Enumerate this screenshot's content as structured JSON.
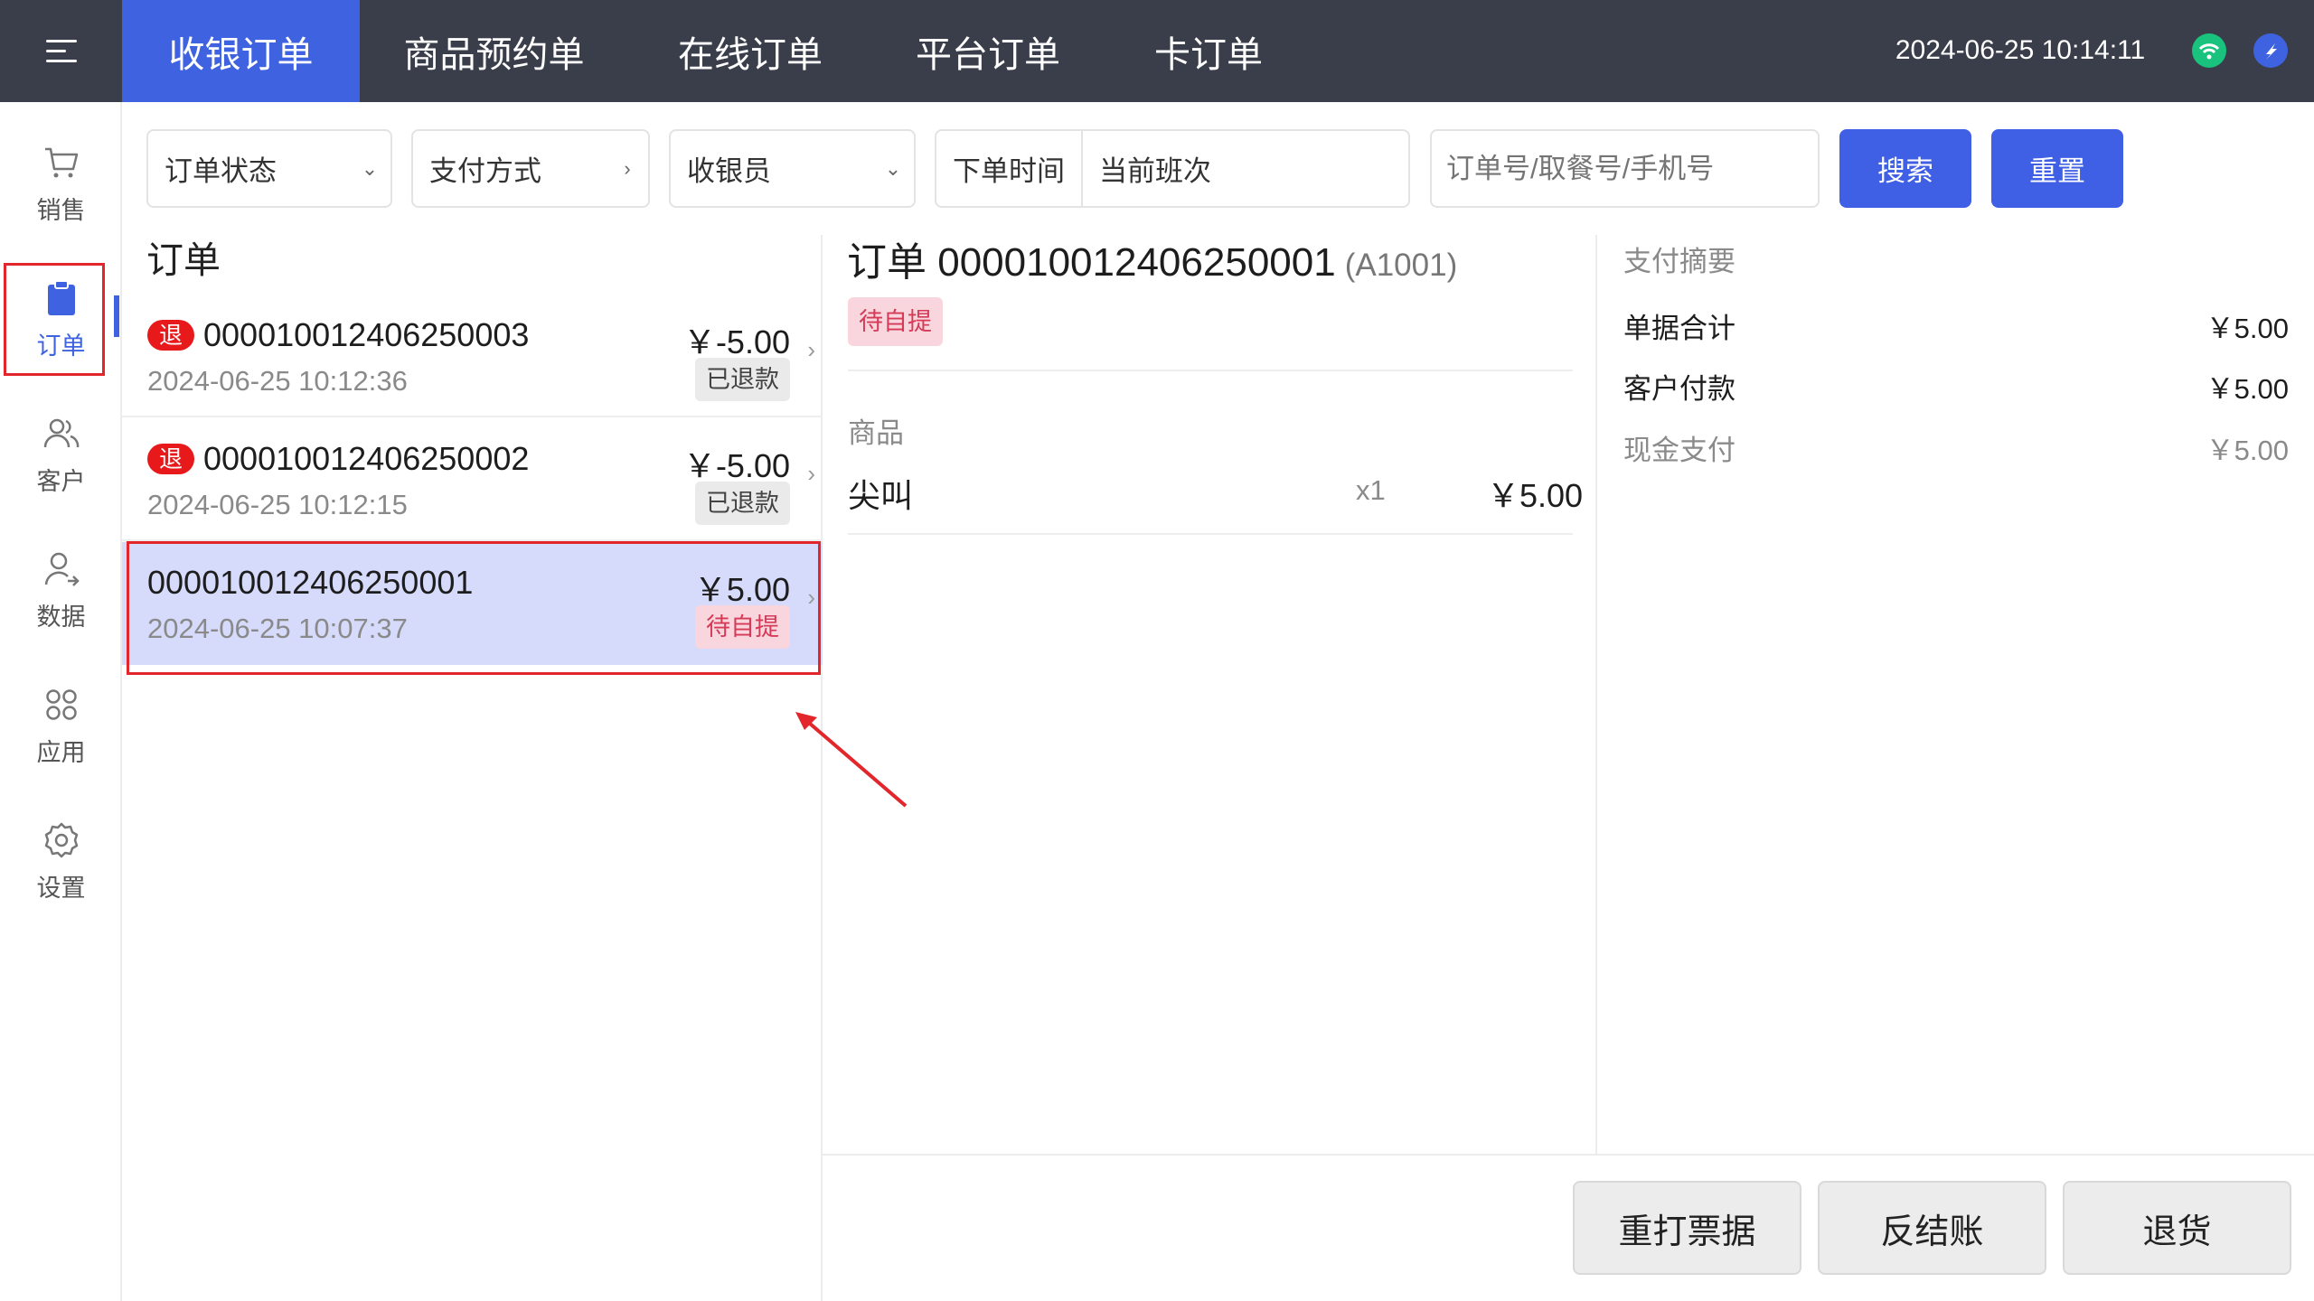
{
  "tabs": [
    {
      "label": "收银订单",
      "active": true
    },
    {
      "label": "商品预约单",
      "active": false
    },
    {
      "label": "在线订单",
      "active": false
    },
    {
      "label": "平台订单",
      "active": false
    },
    {
      "label": "卡订单",
      "active": false
    }
  ],
  "clock": "2024-06-25 10:14:11",
  "sidebar": [
    {
      "label": "销售",
      "icon": "cart-icon"
    },
    {
      "label": "订单",
      "icon": "clipboard-icon",
      "active": true
    },
    {
      "label": "客户",
      "icon": "users-icon"
    },
    {
      "label": "数据",
      "icon": "user-share-icon"
    },
    {
      "label": "应用",
      "icon": "apps-icon"
    },
    {
      "label": "设置",
      "icon": "gear-icon"
    }
  ],
  "filters": {
    "status": "订单状态",
    "payment": "支付方式",
    "cashier": "收银员",
    "time_label": "下单时间",
    "time_value": "当前班次",
    "search_placeholder": "订单号/取餐号/手机号",
    "search_btn": "搜索",
    "reset_btn": "重置"
  },
  "list": {
    "title": "订单",
    "orders": [
      {
        "refund_tag": "退",
        "no": "000010012406250003",
        "time": "2024-06-25 10:12:36",
        "amount": "￥-5.00",
        "status": "已退款"
      },
      {
        "refund_tag": "退",
        "no": "000010012406250002",
        "time": "2024-06-25 10:12:15",
        "amount": "￥-5.00",
        "status": "已退款"
      },
      {
        "refund_tag": "",
        "no": "000010012406250001",
        "time": "2024-06-25 10:07:37",
        "amount": "￥5.00",
        "status": "待自提"
      }
    ]
  },
  "detail": {
    "title": "订单 000010012406250001",
    "code": "(A1001)",
    "status": "待自提",
    "goods_label": "商品",
    "goods": [
      {
        "name": "尖叫",
        "qty": "x1",
        "price": "￥5.00"
      }
    ]
  },
  "payment": {
    "title": "支付摘要",
    "rows": [
      {
        "label": "单据合计",
        "value": "￥5.00"
      },
      {
        "label": "客户付款",
        "value": "￥5.00"
      },
      {
        "label": "现金支付",
        "value": "￥5.00"
      }
    ]
  },
  "actions": {
    "reprint": "重打票据",
    "unsettle": "反结账",
    "return": "退货"
  },
  "colors": {
    "accent": "#3f63e0",
    "topbar": "#3a3e4a",
    "annotation": "#e2262b"
  }
}
